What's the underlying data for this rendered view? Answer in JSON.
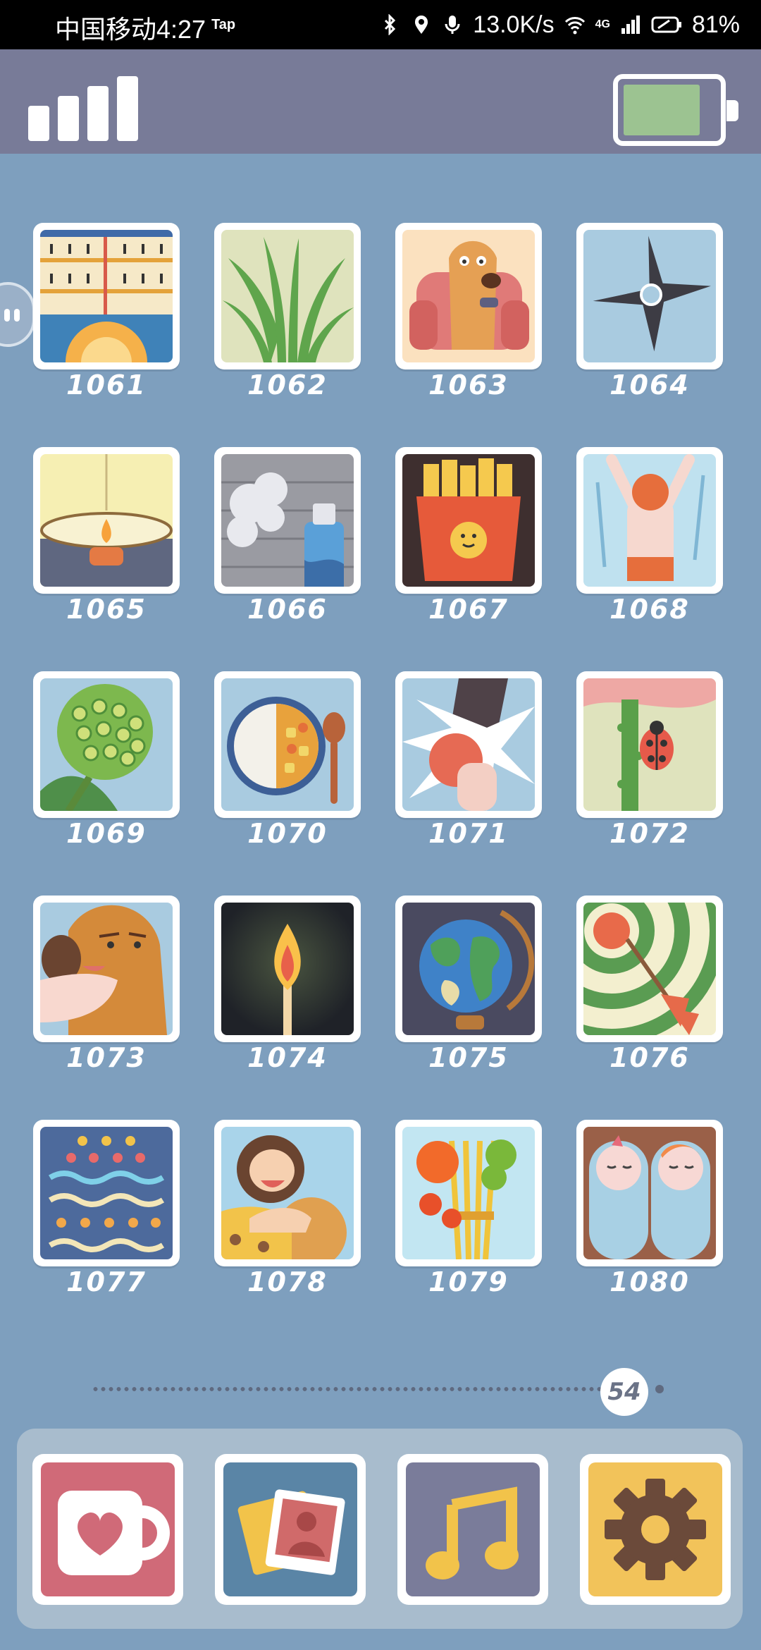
{
  "status_bar": {
    "carrier_time": "中国移动4:27",
    "tap_badge": "Tap",
    "speed": "13.0K/s",
    "network": "4G",
    "battery_percent": "81%"
  },
  "top_bar": {
    "signal_icon": "signal-bars-icon",
    "battery_icon": "battery-icon",
    "battery_level": 0.8
  },
  "grid": {
    "items": [
      {
        "number": "1061",
        "icon": "thermometer-sunrise"
      },
      {
        "number": "1062",
        "icon": "green-onions"
      },
      {
        "number": "1063",
        "icon": "dog-on-couch"
      },
      {
        "number": "1064",
        "icon": "shuriken"
      },
      {
        "number": "1065",
        "icon": "candle-bowl"
      },
      {
        "number": "1066",
        "icon": "spray-can"
      },
      {
        "number": "1067",
        "icon": "french-fries"
      },
      {
        "number": "1068",
        "icon": "swimmer"
      },
      {
        "number": "1069",
        "icon": "lotus-pod"
      },
      {
        "number": "1070",
        "icon": "curry-rice"
      },
      {
        "number": "1071",
        "icon": "punch"
      },
      {
        "number": "1072",
        "icon": "ladybug"
      },
      {
        "number": "1073",
        "icon": "sick-potato"
      },
      {
        "number": "1074",
        "icon": "match-flame"
      },
      {
        "number": "1075",
        "icon": "globe"
      },
      {
        "number": "1076",
        "icon": "dart-target"
      },
      {
        "number": "1077",
        "icon": "cake-layers"
      },
      {
        "number": "1078",
        "icon": "caveman"
      },
      {
        "number": "1079",
        "icon": "fruit-bundle"
      },
      {
        "number": "1080",
        "icon": "twin-babies"
      }
    ]
  },
  "pager": {
    "current_page": "54"
  },
  "dock": {
    "apps": [
      {
        "name": "favorites",
        "icon": "heart-cup-icon",
        "color": "#d06a78"
      },
      {
        "name": "photos",
        "icon": "photo-stack-icon",
        "color": "#5a85a6"
      },
      {
        "name": "music",
        "icon": "music-note-icon",
        "color": "#7a7c9a"
      },
      {
        "name": "settings",
        "icon": "gear-icon",
        "color": "#f2c35a"
      }
    ]
  }
}
